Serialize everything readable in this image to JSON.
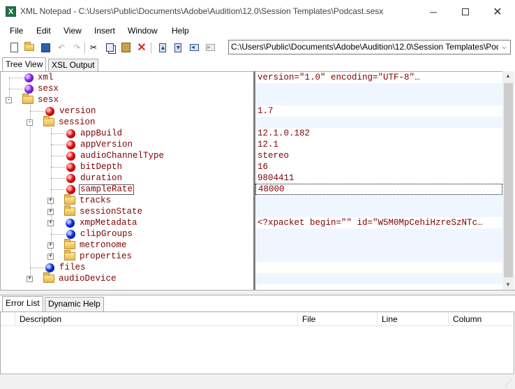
{
  "window": {
    "title": "XML Notepad - C:\\Users\\Public\\Documents\\Adobe\\Audition\\12.0\\Session Templates\\Podcast.sesx",
    "icon_letter": "X"
  },
  "menu": [
    "File",
    "Edit",
    "View",
    "Insert",
    "Window",
    "Help"
  ],
  "toolbar": {
    "path": "C:\\Users\\Public\\Documents\\Adobe\\Audition\\12.0\\Session Templates\\Podcast.sesx"
  },
  "tabs": {
    "tree_view": "Tree View",
    "xsl_output": "XSL Output"
  },
  "tree": [
    {
      "name": "xml",
      "kind": "pi",
      "value": "version=\"1.0\" encoding=\"UTF-8\"…"
    },
    {
      "name": "sesx",
      "kind": "pi",
      "value": ""
    },
    {
      "name": "sesx",
      "kind": "folder",
      "value": ""
    },
    {
      "name": "version",
      "kind": "attr",
      "value": "1.7"
    },
    {
      "name": "session",
      "kind": "folder",
      "value": ""
    },
    {
      "name": "appBuild",
      "kind": "attr",
      "value": "12.1.0.182"
    },
    {
      "name": "appVersion",
      "kind": "attr",
      "value": "12.1"
    },
    {
      "name": "audioChannelType",
      "kind": "attr",
      "value": "stereo"
    },
    {
      "name": "bitDepth",
      "kind": "attr",
      "value": "16"
    },
    {
      "name": "duration",
      "kind": "attr",
      "value": "9804411"
    },
    {
      "name": "sampleRate",
      "kind": "attr",
      "value": "48000"
    },
    {
      "name": "tracks",
      "kind": "folder",
      "value": ""
    },
    {
      "name": "sessionState",
      "kind": "folder",
      "value": ""
    },
    {
      "name": "xmpMetadata",
      "kind": "leaf",
      "value": "<?xpacket begin=\"\" id=\"W5M0MpCehiHzreSzNTc…"
    },
    {
      "name": "clipGroups",
      "kind": "leaf",
      "value": ""
    },
    {
      "name": "metronome",
      "kind": "folder",
      "value": ""
    },
    {
      "name": "properties",
      "kind": "folder",
      "value": ""
    },
    {
      "name": "files",
      "kind": "leaf",
      "value": ""
    },
    {
      "name": "audioDevice",
      "kind": "folder",
      "value": ""
    }
  ],
  "bottom_tabs": {
    "error_list": "Error List",
    "dynamic_help": "Dynamic Help"
  },
  "error_columns": [
    "Description",
    "File",
    "Line",
    "Column"
  ]
}
